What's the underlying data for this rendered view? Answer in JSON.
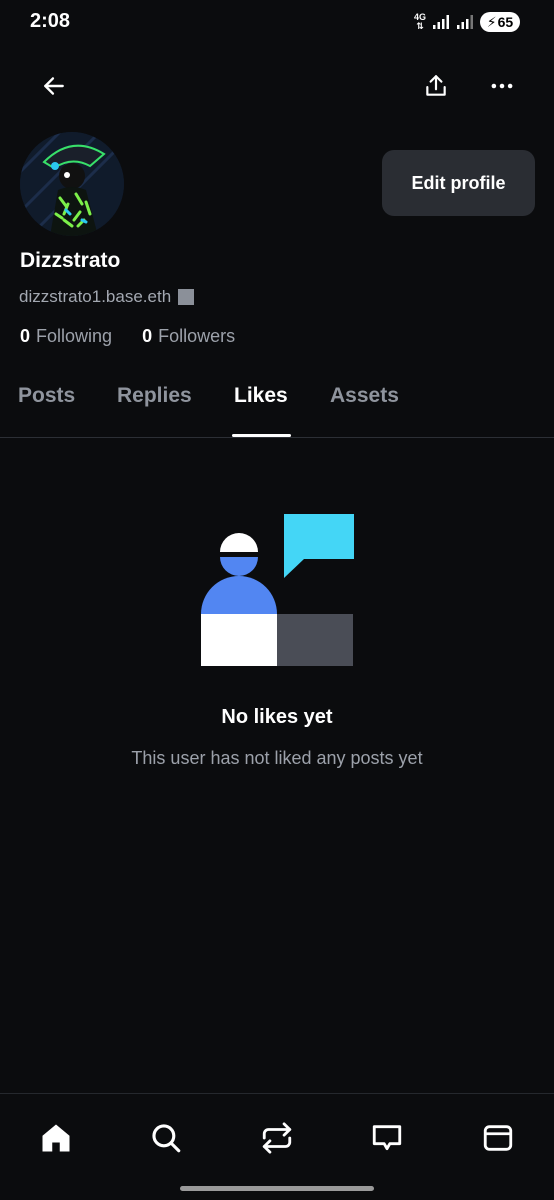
{
  "status_bar": {
    "time": "2:08",
    "network_type": "4G",
    "battery_level": "65"
  },
  "top_bar": {
    "back_icon": "arrow-left-icon",
    "share_icon": "share-upload-icon",
    "more_icon": "ellipsis-icon"
  },
  "profile": {
    "display_name": "Dizzstrato",
    "handle": "dizzstrato1.base.eth",
    "edit_button": "Edit profile",
    "following_count": "0",
    "following_label": "Following",
    "followers_count": "0",
    "followers_label": "Followers"
  },
  "tabs": [
    {
      "label": "Posts",
      "active": false
    },
    {
      "label": "Replies",
      "active": false
    },
    {
      "label": "Likes",
      "active": true
    },
    {
      "label": "Assets",
      "active": false
    }
  ],
  "empty_state": {
    "title": "No likes yet",
    "subtitle": "This user has not liked any posts yet"
  },
  "bottom_nav": [
    {
      "icon": "home-icon",
      "active": true
    },
    {
      "icon": "search-icon",
      "active": false
    },
    {
      "icon": "repost-icon",
      "active": false
    },
    {
      "icon": "messages-icon",
      "active": false
    },
    {
      "icon": "wallet-icon",
      "active": false
    }
  ],
  "colors": {
    "background": "#0b0c0e",
    "button_bg": "#2a2d33",
    "muted_text": "#9ca1aa",
    "illustration_blue": "#5286f2",
    "illustration_cyan": "#44d6f6",
    "illustration_gray": "#4a4d56"
  }
}
